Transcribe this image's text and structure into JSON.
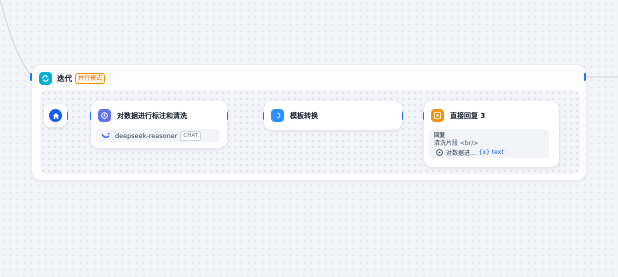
{
  "iteration": {
    "title": "迭代",
    "mode_badge": "并行模式"
  },
  "nodes": {
    "llm": {
      "title": "对数据进行标注和清洗",
      "model_name": "deepseek-reasoner",
      "model_mode": "CHAT"
    },
    "template": {
      "title": "模板转换"
    },
    "answer": {
      "title": "直接回复 3",
      "section_label": "回复",
      "content_line": "清洗片段 <br/>",
      "ref_node": "对数据进...",
      "ref_var": "{x} text"
    }
  },
  "colors": {
    "iteration_icon": "#06aed4",
    "start_icon": "#155eef",
    "llm_icon": "#6172f3",
    "template_icon": "#2e90fa",
    "answer_icon": "#f79009",
    "mode_badge": "#dc6803",
    "edge": "#d0d5dd",
    "handle": "#2970ff"
  },
  "icons": {
    "iteration": "loop-icon",
    "start": "home-icon",
    "llm": "brain-icon",
    "template": "template-icon",
    "answer": "reply-icon",
    "model": "deepseek-whale-icon",
    "ref": "node-ref-icon"
  }
}
